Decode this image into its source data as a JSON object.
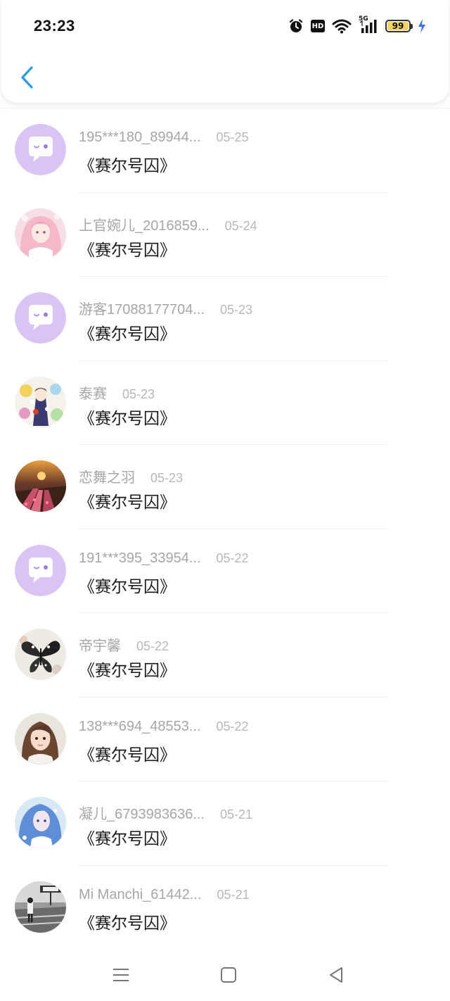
{
  "status_bar": {
    "time": "23:23",
    "network": "5G",
    "hd": "HD",
    "battery": "99",
    "battery_level": 0.99,
    "icons": [
      "alarm-icon",
      "hd-icon",
      "wifi-icon",
      "signal-5g-icon",
      "battery-icon",
      "charging-icon"
    ]
  },
  "header": {
    "back_icon": "chevron-left-icon",
    "accent": "#2b9ce5"
  },
  "comments": [
    {
      "name": "195***180_89944...",
      "date": "05-25",
      "content": "《赛尔号囚》",
      "avatar": "default-chat-avatar"
    },
    {
      "name": "上官婉儿_2016859...",
      "date": "05-24",
      "content": "《赛尔号囚》",
      "avatar": "pink-hair-girl-avatar"
    },
    {
      "name": "游客17088177704...",
      "date": "05-23",
      "content": "《赛尔号囚》",
      "avatar": "default-chat-avatar"
    },
    {
      "name": "泰赛",
      "date": "05-23",
      "content": "《赛尔号囚》",
      "avatar": "anime-flowers-avatar"
    },
    {
      "name": "恋舞之羽",
      "date": "05-23",
      "content": "《赛尔号囚》",
      "avatar": "tulip-field-sunset-avatar"
    },
    {
      "name": "191***395_33954...",
      "date": "05-22",
      "content": "《赛尔号囚》",
      "avatar": "default-chat-avatar"
    },
    {
      "name": "帝宇馨",
      "date": "05-22",
      "content": "《赛尔号囚》",
      "avatar": "butterfly-avatar"
    },
    {
      "name": "138***694_48553...",
      "date": "05-22",
      "content": "《赛尔号囚》",
      "avatar": "girl-portrait-avatar"
    },
    {
      "name": "凝儿_6793983636...",
      "date": "05-21",
      "content": "《赛尔号囚》",
      "avatar": "blue-hair-girl-avatar"
    },
    {
      "name": "Mi Manchi_61442...",
      "date": "05-21",
      "content": "《赛尔号囚》",
      "avatar": "street-photo-avatar"
    }
  ],
  "nav_bar": {
    "items": [
      "menu-icon",
      "home-square-icon",
      "back-triangle-icon"
    ]
  }
}
